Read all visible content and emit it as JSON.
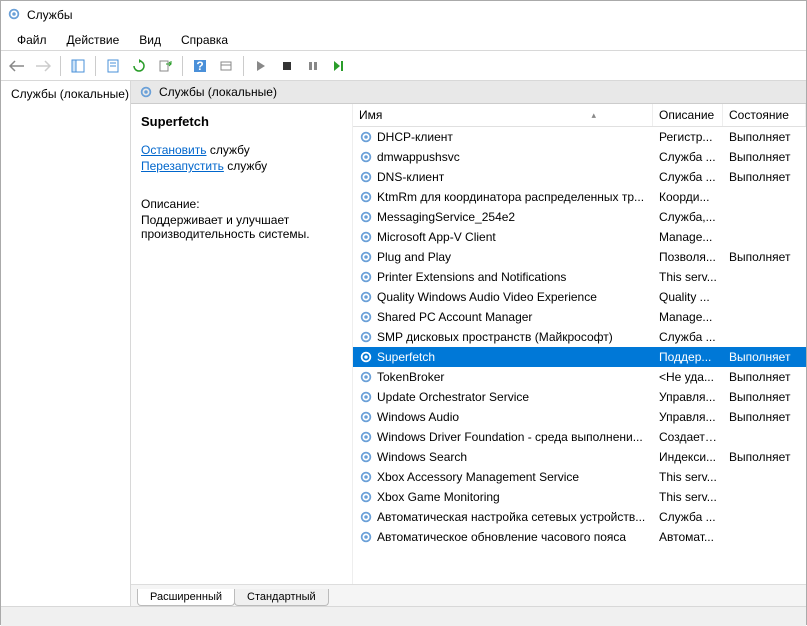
{
  "window": {
    "title": "Службы"
  },
  "menu": {
    "file": "Файл",
    "action": "Действие",
    "view": "Вид",
    "help": "Справка"
  },
  "tree": {
    "root": "Службы (локальные)"
  },
  "header": {
    "title": "Службы (локальные)"
  },
  "detail": {
    "name": "Superfetch",
    "stop_link": "Остановить",
    "stop_suffix": " службу",
    "restart_link": "Перезапустить",
    "restart_suffix": " службу",
    "desc_label": "Описание:",
    "desc_text": "Поддерживает и улучшает производительность системы."
  },
  "columns": {
    "name": "Имя",
    "desc": "Описание",
    "status": "Состояние"
  },
  "services": [
    {
      "name": "DHCP-клиент",
      "desc": "Регистр...",
      "status": "Выполняет"
    },
    {
      "name": "dmwappushsvc",
      "desc": "Служба ...",
      "status": "Выполняет"
    },
    {
      "name": "DNS-клиент",
      "desc": "Служба ...",
      "status": "Выполняет"
    },
    {
      "name": "KtmRm для координатора распределенных тр...",
      "desc": "Коорди...",
      "status": ""
    },
    {
      "name": "MessagingService_254e2",
      "desc": "Служба,...",
      "status": ""
    },
    {
      "name": "Microsoft App-V Client",
      "desc": "Manage...",
      "status": ""
    },
    {
      "name": "Plug and Play",
      "desc": "Позволя...",
      "status": "Выполняет"
    },
    {
      "name": "Printer Extensions and Notifications",
      "desc": "This serv...",
      "status": ""
    },
    {
      "name": "Quality Windows Audio Video Experience",
      "desc": "Quality ...",
      "status": ""
    },
    {
      "name": "Shared PC Account Manager",
      "desc": "Manage...",
      "status": ""
    },
    {
      "name": "SMP дисковых пространств (Майкрософт)",
      "desc": "Служба ...",
      "status": ""
    },
    {
      "name": "Superfetch",
      "desc": "Поддер...",
      "status": "Выполняет",
      "selected": true
    },
    {
      "name": "TokenBroker",
      "desc": "<Не уда...",
      "status": "Выполняет"
    },
    {
      "name": "Update Orchestrator Service",
      "desc": "Управля...",
      "status": "Выполняет"
    },
    {
      "name": "Windows Audio",
      "desc": "Управля...",
      "status": "Выполняет"
    },
    {
      "name": "Windows Driver Foundation - среда выполнени...",
      "desc": "Создает ...",
      "status": ""
    },
    {
      "name": "Windows Search",
      "desc": "Индекси...",
      "status": "Выполняет"
    },
    {
      "name": "Xbox Accessory Management Service",
      "desc": "This serv...",
      "status": ""
    },
    {
      "name": "Xbox Game Monitoring",
      "desc": "This serv...",
      "status": ""
    },
    {
      "name": "Автоматическая настройка сетевых устройств...",
      "desc": "Служба ...",
      "status": ""
    },
    {
      "name": "Автоматическое обновление часового пояса",
      "desc": "Автомат...",
      "status": ""
    }
  ],
  "tabs": {
    "extended": "Расширенный",
    "standard": "Стандартный"
  }
}
